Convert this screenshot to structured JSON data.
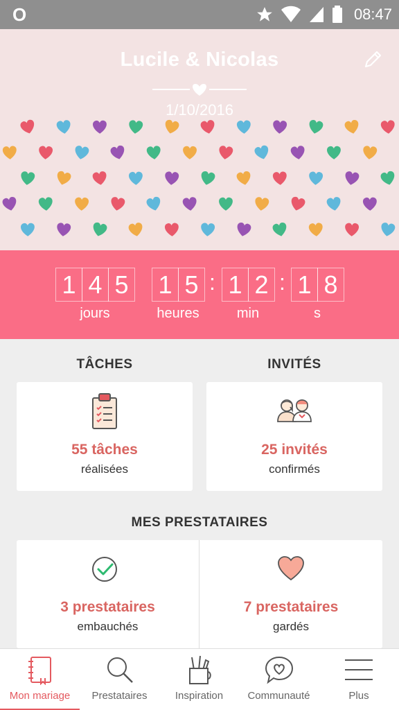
{
  "status_bar": {
    "carrier": "O",
    "time": "08:47"
  },
  "header": {
    "names": "Lucile & Nicolas",
    "date": "1/10/2016",
    "edit_icon": "pencil-icon"
  },
  "countdown": {
    "days": [
      "1",
      "4",
      "5"
    ],
    "hours": [
      "1",
      "5"
    ],
    "minutes": [
      "1",
      "2"
    ],
    "seconds": [
      "1",
      "8"
    ],
    "labels": {
      "days": "jours",
      "hours": "heures",
      "minutes": "min",
      "seconds": "s"
    }
  },
  "tasks": {
    "title": "TÂCHES",
    "value": "55 tâches",
    "sub": "réalisées"
  },
  "guests": {
    "title": "INVITÉS",
    "value": "25 invités",
    "sub": "confirmés"
  },
  "vendors": {
    "title": "MES PRESTATAIRES",
    "hired": {
      "value": "3 prestataires",
      "sub": "embauchés"
    },
    "kept": {
      "value": "7 prestataires",
      "sub": "gardés"
    }
  },
  "nav": {
    "items": [
      {
        "label": "Mon mariage",
        "icon": "notebook-icon"
      },
      {
        "label": "Prestataires",
        "icon": "search-icon"
      },
      {
        "label": "Inspiration",
        "icon": "brush-cup-icon"
      },
      {
        "label": "Communauté",
        "icon": "chat-heart-icon"
      },
      {
        "label": "Plus",
        "icon": "menu-icon"
      }
    ]
  },
  "colors": {
    "accent": "#fa6d86",
    "highlight": "#d96561",
    "hero_bg": "#f3e3e3"
  }
}
